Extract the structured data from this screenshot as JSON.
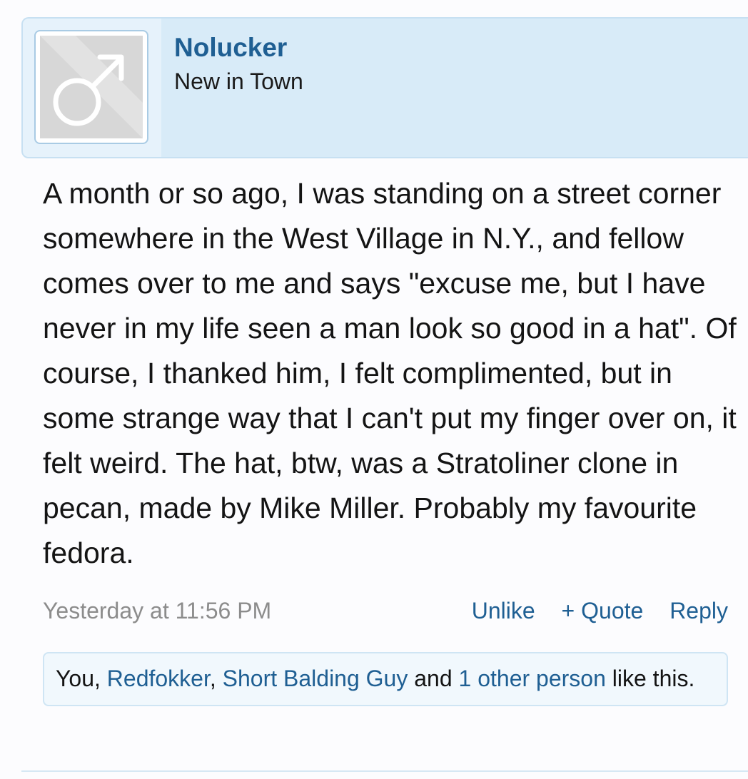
{
  "post": {
    "user": {
      "name": "Nolucker",
      "title": "New in Town",
      "avatar": {
        "icon": "male-symbol-icon",
        "background": "#d7d7d7"
      }
    },
    "message": "A month or so ago, I was standing on a street corner somewhere in the West Village in N.Y., and fellow comes over to me and says \"excuse me, but I have never in my life seen a man look so good in a hat\". Of course, I thanked him, I felt complimented, but in some strange way that I can't put my finger over on, it felt weird. The hat, btw, was a Stratoliner clone in pecan, made by Mike Miller. Probably my favourite fedora.",
    "date": "Yesterday at 11:56 PM",
    "actions": {
      "unlike": "Unlike",
      "quote": "+ Quote",
      "reply": "Reply"
    },
    "likes": {
      "prefix": "You, ",
      "user1": "Redfokker",
      "sep": ", ",
      "user2": "Short Balding Guy",
      "and": " and ",
      "others": "1 other person",
      "suffix": " like this."
    }
  },
  "colors": {
    "link": "#1f5f93",
    "header_bg": "#d8ebf8",
    "muted": "#8c8c8c"
  }
}
